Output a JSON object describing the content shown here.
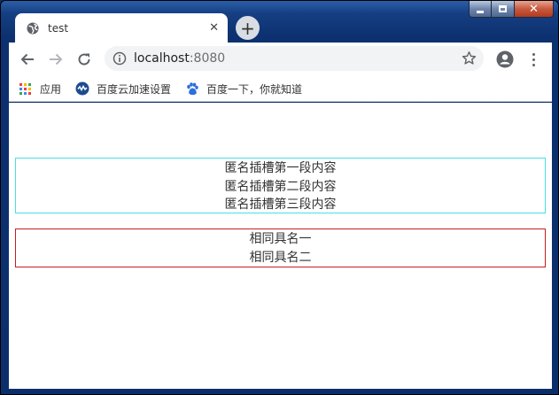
{
  "window": {
    "colors": {
      "caption": "#0b2f6b",
      "close_button": "#c75a40"
    }
  },
  "tab": {
    "title": "test",
    "close_glyph": "✕",
    "favicon": "globe-icon"
  },
  "newtab": {
    "glyph": "+"
  },
  "toolbar": {
    "url_host": "localhost",
    "url_port": ":8080"
  },
  "bookmarks": [
    {
      "label": "应用",
      "icon": "apps-grid-icon"
    },
    {
      "label": "百度云加速设置",
      "icon": "baidu-cloud-icon"
    },
    {
      "label": "百度一下，你就知道",
      "icon": "baidu-paw-icon"
    }
  ],
  "content": {
    "anonymous_slot_lines": [
      "匿名插槽第一段内容",
      "匿名插槽第二段内容",
      "匿名插槽第三段内容"
    ],
    "named_slot_lines": [
      "相同具名一",
      "相同具名二"
    ],
    "colors": {
      "anonymous_border": "#46dfe6",
      "named_border": "#c81e1e"
    }
  }
}
